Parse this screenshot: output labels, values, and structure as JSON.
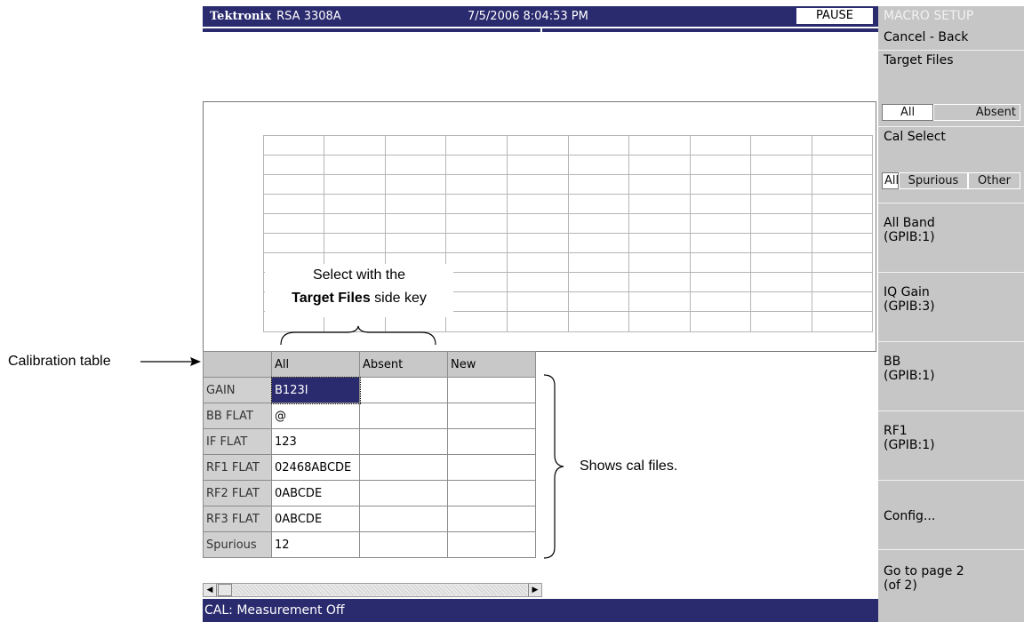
{
  "header": {
    "brand": "Tektronix",
    "model": "RSA 3308A",
    "datetime": "7/5/2006 8:04:53 PM",
    "run_state": "PAUSE"
  },
  "side_menu": {
    "title": "MACRO SETUP",
    "cancel_back": "Cancel - Back",
    "target_files": {
      "label": "Target Files",
      "options": [
        "All",
        "Absent"
      ],
      "selected": "All"
    },
    "cal_select": {
      "label": "Cal Select",
      "options": [
        "All",
        "Spurious",
        "Other"
      ],
      "selected": "All"
    },
    "keys": [
      {
        "line1": "All Band",
        "line2": "(GPIB:1)"
      },
      {
        "line1": "IQ Gain",
        "line2": "(GPIB:3)"
      },
      {
        "line1": "BB",
        "line2": "(GPIB:1)"
      },
      {
        "line1": "RF1",
        "line2": "(GPIB:1)"
      },
      {
        "line1": "Config...",
        "line2": ""
      },
      {
        "line1": "Go to page 2",
        "line2": "(of 2)"
      }
    ]
  },
  "cal_table": {
    "columns": [
      "All",
      "Absent",
      "New"
    ],
    "rows": [
      {
        "name": "GAIN",
        "all": "B123I",
        "absent": "",
        "new": ""
      },
      {
        "name": "BB FLAT",
        "all": "@",
        "absent": "",
        "new": ""
      },
      {
        "name": "IF FLAT",
        "all": "123",
        "absent": "",
        "new": ""
      },
      {
        "name": "RF1 FLAT",
        "all": "02468ABCDE",
        "absent": "",
        "new": ""
      },
      {
        "name": "RF2 FLAT",
        "all": "0ABCDE",
        "absent": "",
        "new": ""
      },
      {
        "name": "RF3 FLAT",
        "all": "0ABCDE",
        "absent": "",
        "new": ""
      },
      {
        "name": "Spurious",
        "all": "12",
        "absent": "",
        "new": ""
      }
    ],
    "selected_cell": "B123I"
  },
  "status": "CAL: Measurement Off",
  "annotations": {
    "calibration_table": "Calibration table",
    "select_line1": "Select with the",
    "select_bold": "Target Files",
    "select_rest": " side key",
    "shows": "Shows cal files."
  },
  "colors": {
    "title_bar": "#2a2a6e",
    "side_panel": "#c6c6c6",
    "header_cell": "#c8c8c8"
  }
}
